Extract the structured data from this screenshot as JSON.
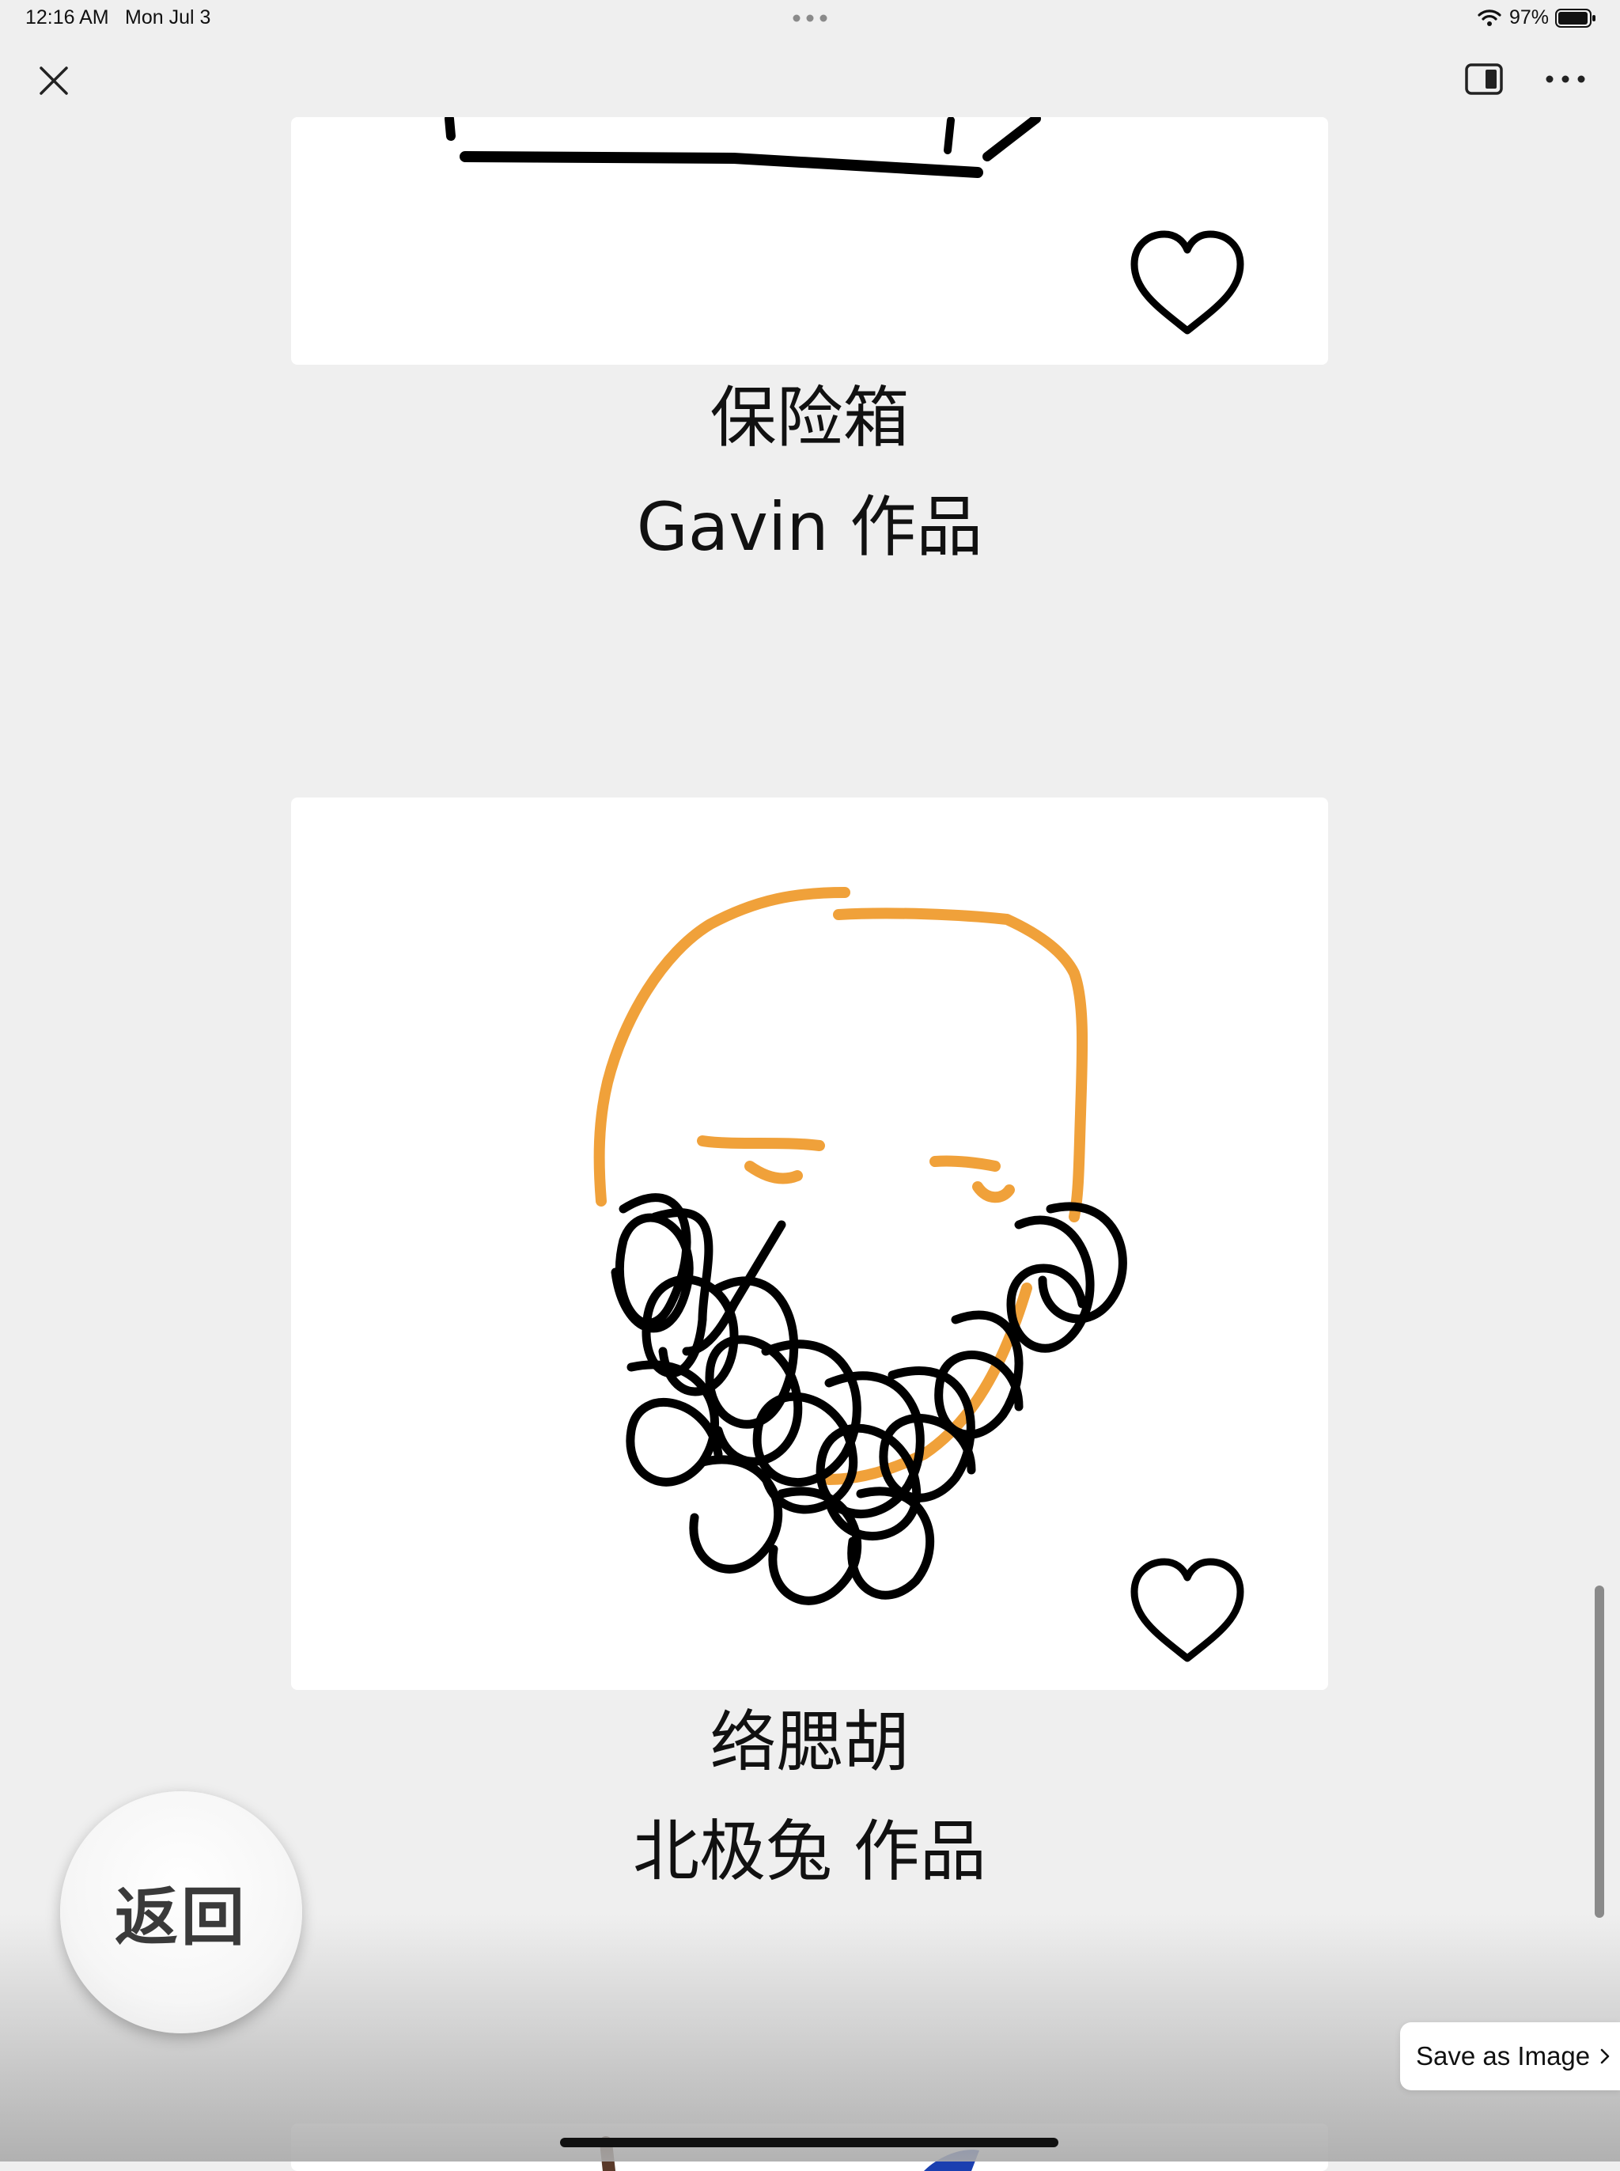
{
  "status_bar": {
    "time": "12:16 AM",
    "date": "Mon Jul 3",
    "battery": "97%"
  },
  "nav": {
    "icons": [
      "close-icon",
      "sidebar-icon",
      "more-icon"
    ]
  },
  "artworks": [
    {
      "title": "保险箱",
      "author": "Gavin 作品"
    },
    {
      "title": "络腮胡",
      "author": "北极兔 作品"
    }
  ],
  "back_button": {
    "label": "返回"
  },
  "save_image": {
    "label": "Save as Image"
  },
  "colors": {
    "background": "#efefef",
    "card": "#ffffff",
    "drawing_orange": "#f0a13a",
    "drawing_black": "#000000",
    "drawing_blue": "#1a3fb0"
  }
}
